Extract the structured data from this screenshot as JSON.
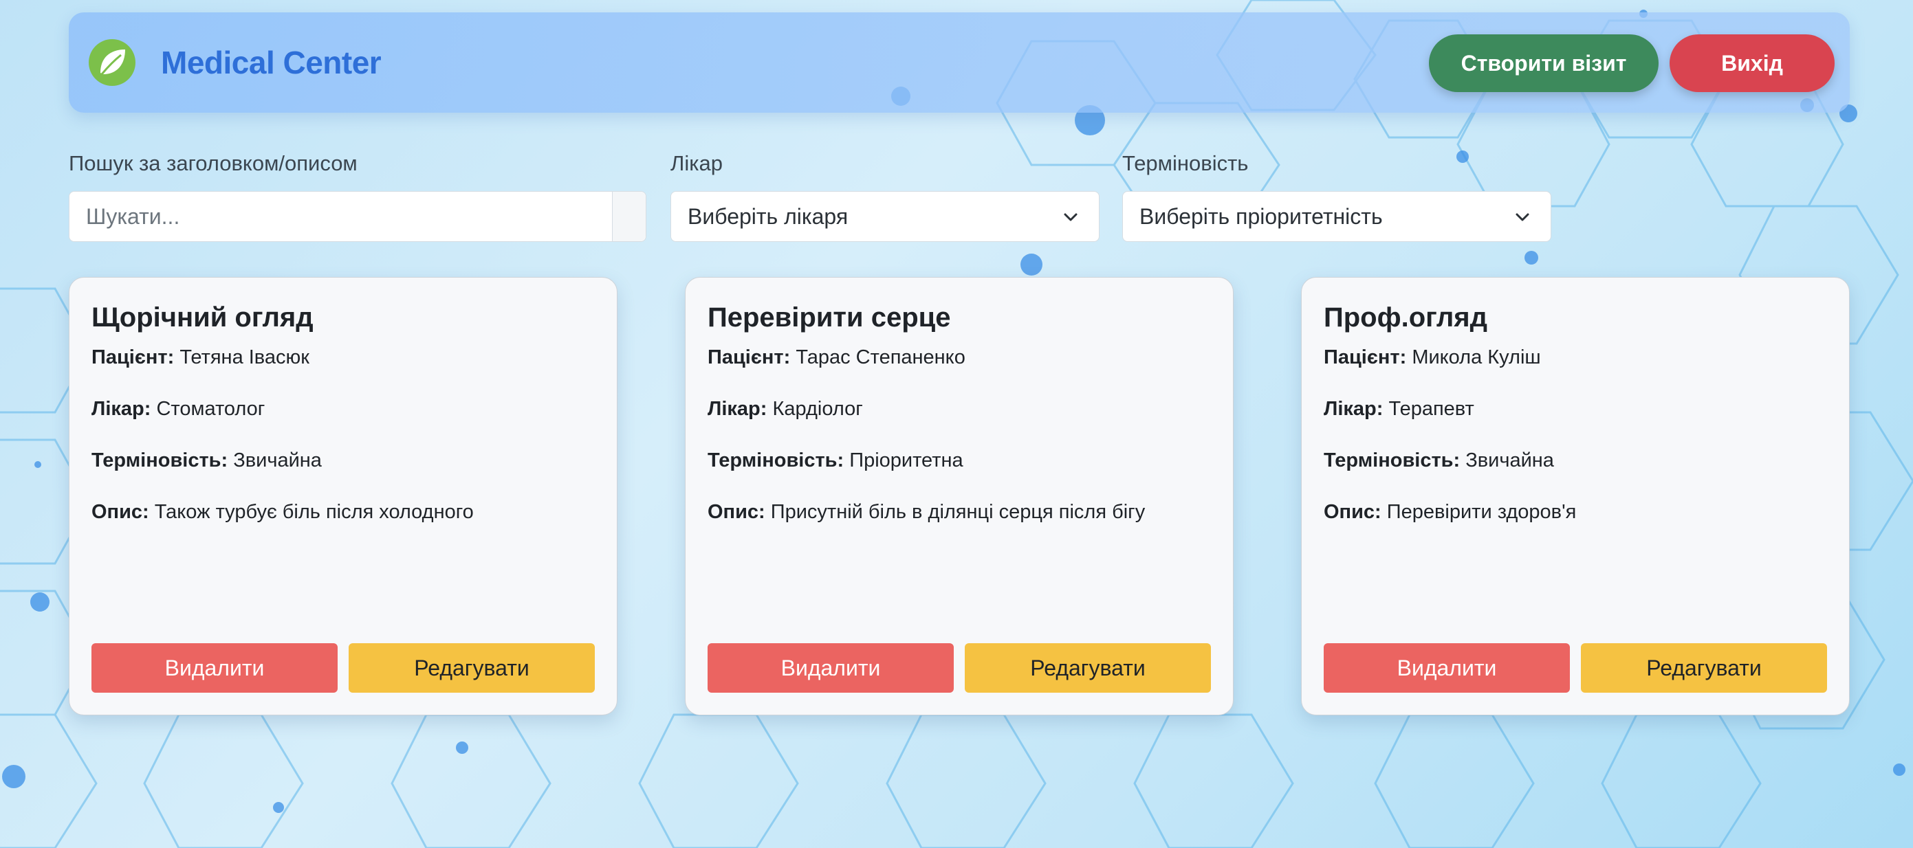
{
  "colors": {
    "brand": "#2e6fd8",
    "create_button": "#3d8a5c",
    "logout_button": "#d94450",
    "delete_button": "#eb6461",
    "edit_button": "#f5c242",
    "logo_leaf": "#7cc04a"
  },
  "header": {
    "logo_icon": "leaf-icon",
    "title": "Medical Center",
    "create_visit_label": "Створити візит",
    "logout_label": "Вихід"
  },
  "filters": {
    "search": {
      "label": "Пошук за заголовком/описом",
      "placeholder": "Шукати...",
      "value": ""
    },
    "doctor": {
      "label": "Лікар",
      "selected": "Виберіть лікаря",
      "icon": "chevron-down-icon"
    },
    "urgency": {
      "label": "Терміновість",
      "selected": "Виберіть пріоритетність",
      "icon": "chevron-down-icon"
    }
  },
  "field_labels": {
    "patient": "Пацієнт:",
    "doctor": "Лікар:",
    "urgency": "Терміновість:",
    "description": "Опис:"
  },
  "cards": [
    {
      "title": "Щорічний огляд",
      "patient": "Тетяна Івасюк",
      "doctor": "Стоматолог",
      "urgency": "Звичайна",
      "description": "Також турбує біль після холодного",
      "delete_label": "Видалити",
      "edit_label": "Редагувати"
    },
    {
      "title": "Перевірити серце",
      "patient": "Тарас Степаненко",
      "doctor": "Кардіолог",
      "urgency": "Пріоритетна",
      "description": "Присутній біль в ділянці серця після бігу",
      "delete_label": "Видалити",
      "edit_label": "Редагувати"
    },
    {
      "title": "Проф.огляд",
      "patient": "Микола Куліш",
      "doctor": "Терапевт",
      "urgency": "Звичайна",
      "description": "Перевірити здоров'я",
      "delete_label": "Видалити",
      "edit_label": "Редагувати"
    }
  ]
}
